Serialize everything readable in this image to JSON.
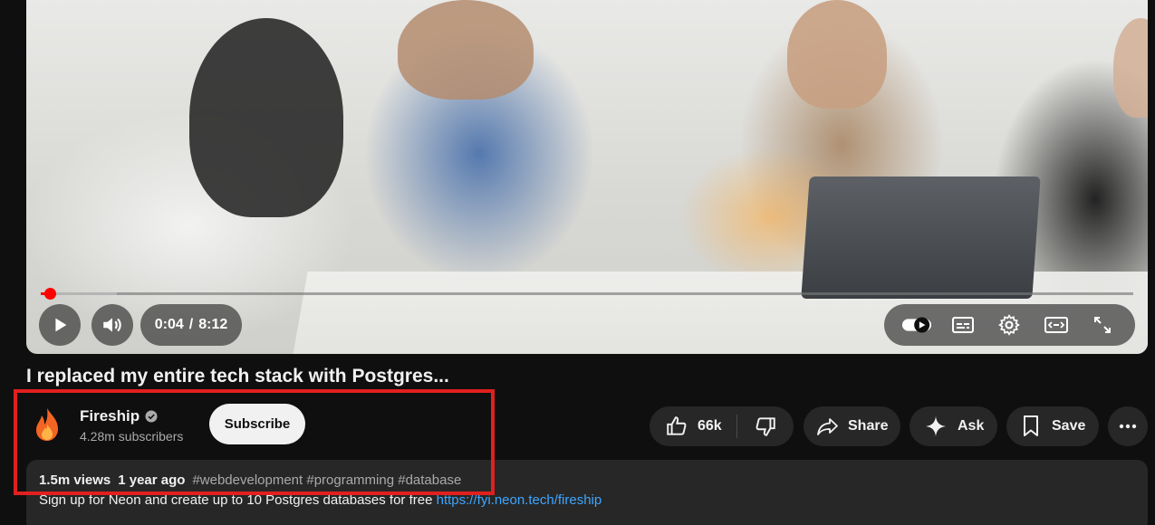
{
  "player": {
    "current_time": "0:04",
    "separator": "/",
    "duration": "8:12",
    "played_fraction": 0.008,
    "loaded_fraction": 0.07
  },
  "video": {
    "title": "I replaced my entire tech stack with Postgres..."
  },
  "channel": {
    "name": "Fireship",
    "subscribers": "4.28m subscribers",
    "subscribe_label": "Subscribe"
  },
  "actions": {
    "likes": "66k",
    "share_label": "Share",
    "ask_label": "Ask",
    "save_label": "Save"
  },
  "description": {
    "views": "1.5m views",
    "age": "1 year ago",
    "hashtags": "#webdevelopment #programming #database",
    "text": "Sign up for Neon and create up to 10 Postgres databases for free",
    "link": "https://fyi.neon.tech/fireship"
  },
  "colors": {
    "progress": "#ff0000",
    "highlight": "#e0201f",
    "link": "#3ea6ff",
    "avatar_flame": "#f26522"
  },
  "icons": {
    "play": "play-icon",
    "volume": "volume-icon",
    "autoplay": "autoplay-toggle-icon",
    "captions": "captions-icon",
    "settings": "gear-icon",
    "theater": "theater-mode-icon",
    "fullscreen": "fullscreen-icon",
    "verified": "verified-check-icon",
    "like": "thumbs-up-icon",
    "dislike": "thumbs-down-icon",
    "share": "share-arrow-icon",
    "ask": "sparkle-icon",
    "save": "bookmark-icon",
    "more": "more-dots-icon"
  }
}
